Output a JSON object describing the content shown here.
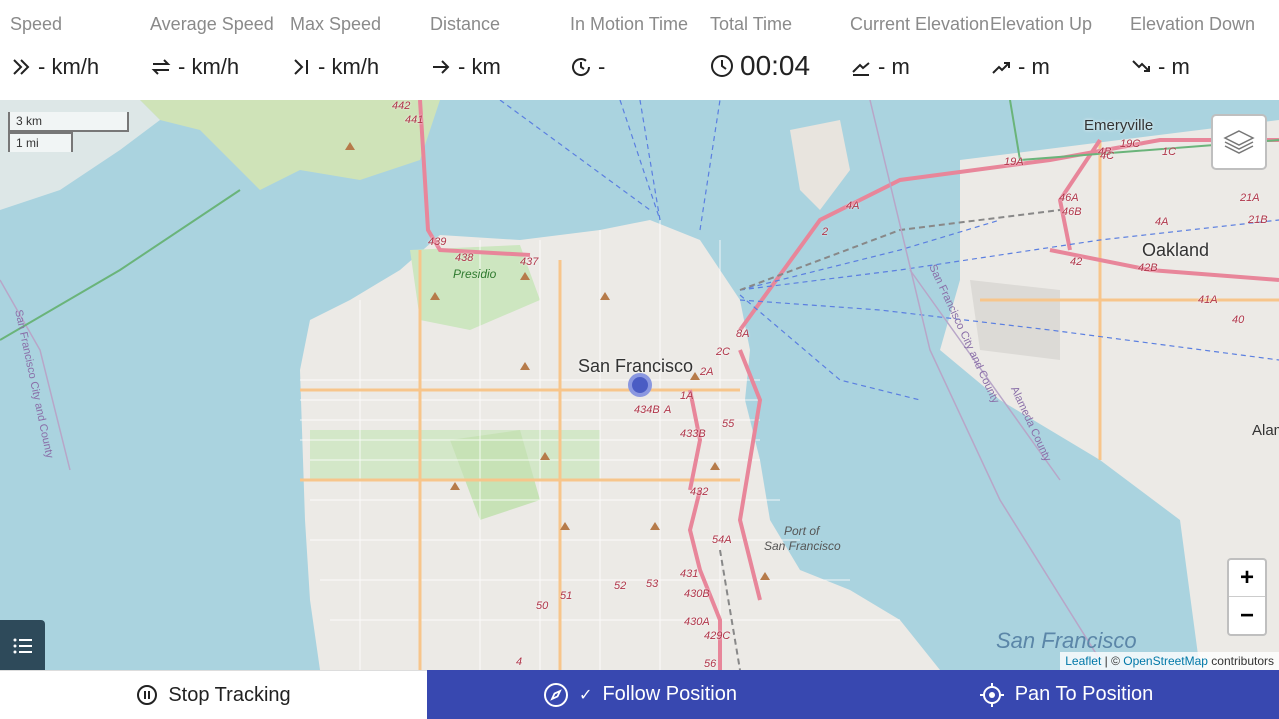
{
  "stats": [
    {
      "label": "Speed",
      "value": "- km/h",
      "icon": "double-chevron-right-icon"
    },
    {
      "label": "Average Speed",
      "value": "- km/h",
      "icon": "arrows-exchange-icon"
    },
    {
      "label": "Max Speed",
      "value": "- km/h",
      "icon": "arrow-to-line-icon"
    },
    {
      "label": "Distance",
      "value": "- km",
      "icon": "arrow-right-icon"
    },
    {
      "label": "In Motion Time",
      "value": "-",
      "icon": "clock-arrow-icon"
    },
    {
      "label": "Total Time",
      "value": "00:04",
      "icon": "clock-icon"
    },
    {
      "label": "Current Elevation",
      "value": "- m",
      "icon": "elevation-icon"
    },
    {
      "label": "Elevation Up",
      "value": "- m",
      "icon": "trend-up-icon"
    },
    {
      "label": "Elevation Down",
      "value": "- m",
      "icon": "trend-down-icon"
    }
  ],
  "map": {
    "scale_km": "3 km",
    "scale_mi": "1 mi",
    "places": {
      "sf": "San Francisco",
      "oakland": "Oakland",
      "emeryville": "Emeryville",
      "presidio": "Presidio",
      "port": "Port of",
      "port2": "San Francisco",
      "sf_water": "San Francisco",
      "sf_county": "San Francisco City and County",
      "sf_county2": "San Francisco City and County",
      "alameda": "Alameda County",
      "ala": "Alam"
    },
    "routes": [
      "442",
      "441",
      "439",
      "438",
      "437",
      "434B",
      "A",
      "1A",
      "433B",
      "432",
      "431",
      "430B",
      "430A",
      "429C",
      "56",
      "55",
      "54A",
      "53",
      "52",
      "51",
      "50",
      "4",
      "4A",
      "2",
      "2A",
      "2C",
      "8A",
      "19A",
      "19C",
      "1C",
      "4A",
      "4B",
      "4C",
      "46A",
      "46B",
      "42",
      "42B",
      "41A",
      "40",
      "21A",
      "21B"
    ],
    "zoom_in": "+",
    "zoom_out": "−",
    "attribution_leaflet": "Leaflet",
    "attribution_sep": " | © ",
    "attribution_osm": "OpenStreetMap",
    "attribution_tail": " contributors"
  },
  "bottom": {
    "stop": "Stop Tracking",
    "follow_check": "✓",
    "follow": "Follow Position",
    "pan": "Pan To Position"
  }
}
